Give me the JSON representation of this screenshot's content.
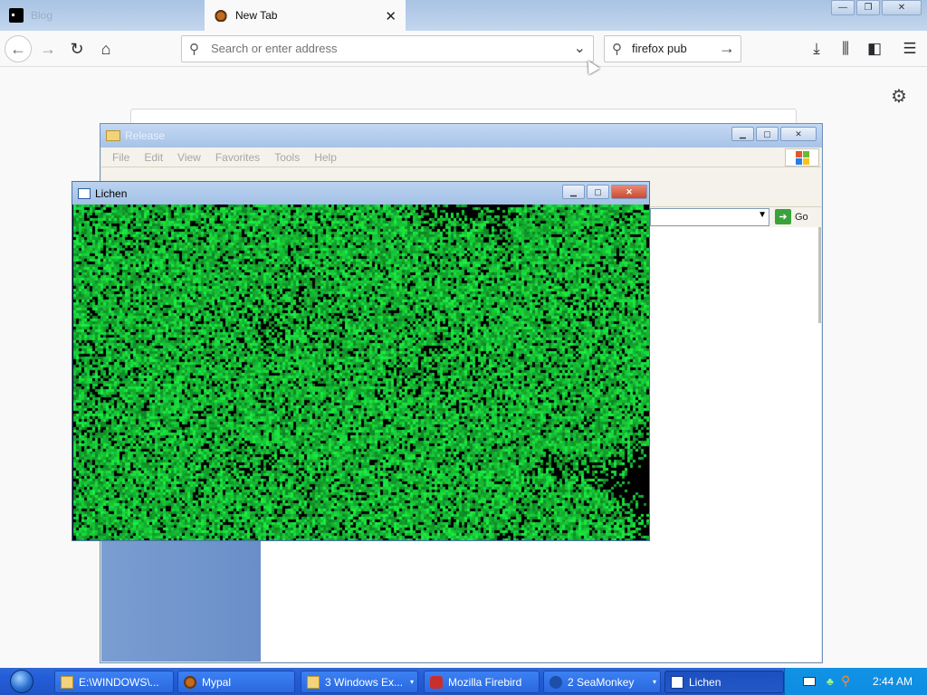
{
  "browser": {
    "tabs": [
      {
        "label": "Blog",
        "active": false
      },
      {
        "label": "New Tab",
        "active": true
      }
    ],
    "new_tab_symbol": "+",
    "url_placeholder": "Search or enter address",
    "search_value": "firefox pub",
    "icons": [
      "back-icon",
      "forward-icon",
      "reload-icon",
      "home-icon",
      "download-icon",
      "library-icon",
      "sidebar-icon",
      "menu-icon",
      "settings-gear-icon"
    ]
  },
  "release_window": {
    "title": "Release",
    "menu": [
      "File",
      "Edit",
      "View",
      "Favorites",
      "Tools",
      "Help"
    ],
    "go_label": "Go"
  },
  "lichen_window": {
    "title": "Lichen",
    "colors": {
      "fill": "#22e04a",
      "background": "#000000"
    }
  },
  "taskbar": {
    "buttons": [
      {
        "label": "E:\\WINDOWS\\..."
      },
      {
        "label": "Mypal"
      },
      {
        "label": "3 Windows Ex...",
        "group_arrow": "▾"
      },
      {
        "label": "Mozilla Firebird"
      },
      {
        "label": "2 SeaMonkey",
        "group_arrow": "▾"
      },
      {
        "label": "Lichen",
        "active": true
      }
    ],
    "clock": "2:44 AM"
  }
}
